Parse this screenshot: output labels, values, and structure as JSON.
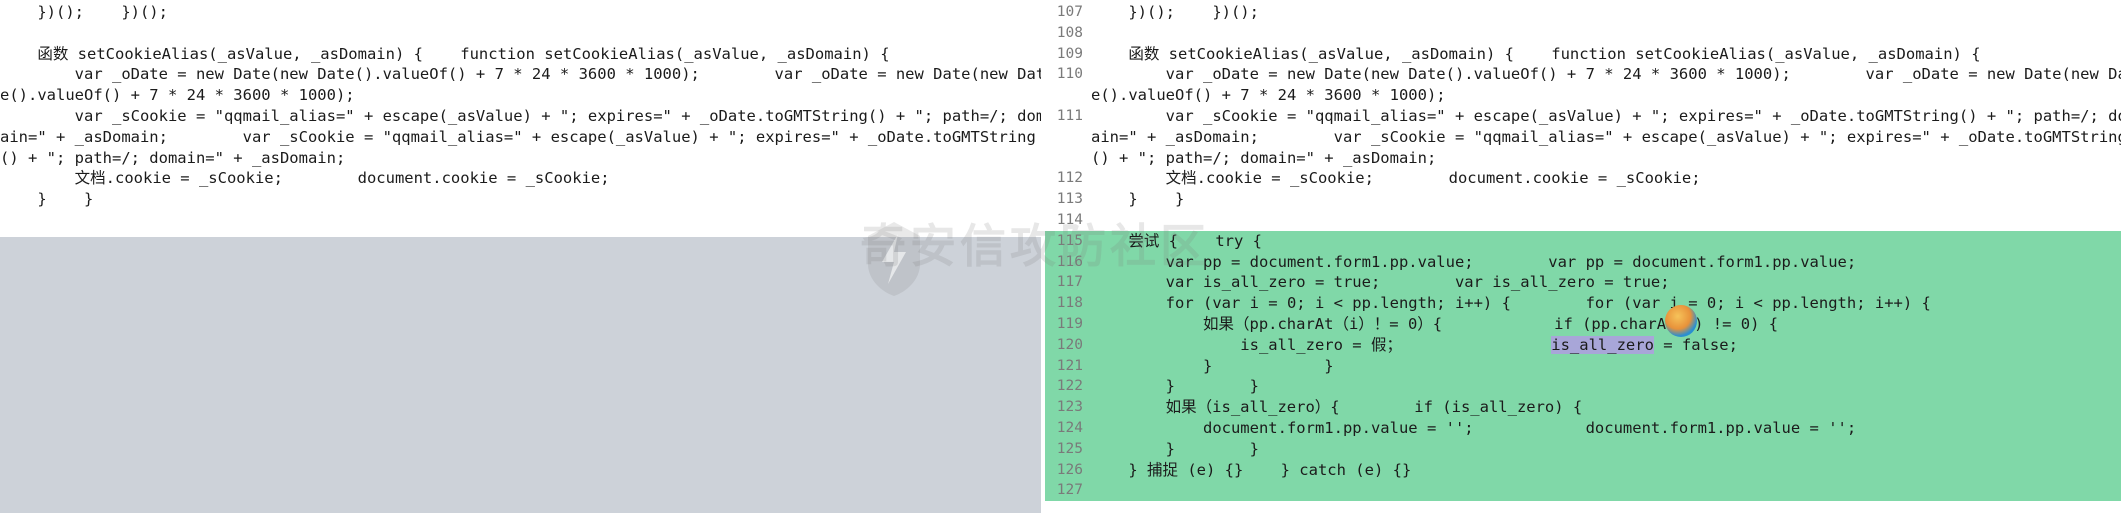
{
  "left_pane": {
    "lines": [
      {
        "code": "    })();    })();"
      },
      {
        "code": ""
      },
      {
        "code": "    函数 setCookieAlias(_asValue, _asDomain) {    function setCookieAlias(_asValue, _asDomain) {"
      },
      {
        "code": "        var _oDate = new Date(new Date().valueOf() + 7 * 24 * 3600 * 1000);        var _oDate = new Date(new Dat\ne().valueOf() + 7 * 24 * 3600 * 1000);"
      },
      {
        "code": "        var _sCookie = \"qqmail_alias=\" + escape(_asValue) + \"; expires=\" + _oDate.toGMTString() + \"; path=/; dom\nain=\" + _asDomain;        var _sCookie = \"qqmail_alias=\" + escape(_asValue) + \"; expires=\" + _oDate.toGMTString\n() + \"; path=/; domain=\" + _asDomain;"
      },
      {
        "code": "        文档.cookie = _sCookie;        document.cookie = _sCookie;"
      },
      {
        "code": "    }    }"
      }
    ]
  },
  "right_pane": {
    "lines": [
      {
        "num": "107",
        "code": "    })();    })();"
      },
      {
        "num": "108",
        "code": ""
      },
      {
        "num": "109",
        "code": "    函数 setCookieAlias(_asValue, _asDomain) {    function setCookieAlias(_asValue, _asDomain) {"
      },
      {
        "num": "110",
        "code": "        var _oDate = new Date(new Date().valueOf() + 7 * 24 * 3600 * 1000);        var _oDate = new Date(new Dat\ne().valueOf() + 7 * 24 * 3600 * 1000);"
      },
      {
        "num": "111",
        "code": "        var _sCookie = \"qqmail_alias=\" + escape(_asValue) + \"; expires=\" + _oDate.toGMTString() + \"; path=/; dom\nain=\" + _asDomain;        var _sCookie = \"qqmail_alias=\" + escape(_asValue) + \"; expires=\" + _oDate.toGMTString\n() + \"; path=/; domain=\" + _asDomain;"
      },
      {
        "num": "112",
        "code": "        文档.cookie = _sCookie;        document.cookie = _sCookie;"
      },
      {
        "num": "113",
        "code": "    }    }"
      },
      {
        "num": "114",
        "code": ""
      },
      {
        "num": "115",
        "code": "    尝试 {    try {"
      },
      {
        "num": "116",
        "code": "        var pp = document.form1.pp.value;        var pp = document.form1.pp.value;"
      },
      {
        "num": "117",
        "code": "        var is_all_zero = true;        var is_all_zero = true;"
      },
      {
        "num": "118",
        "code": "        for (var i = 0; i < pp.length; i++) {        for (var i = 0; i < pp.length; i++) {"
      },
      {
        "num": "119",
        "code": "            如果（pp.charAt（i）！= 0）{            if (pp.charAt(i) != 0) {"
      },
      {
        "num": "120",
        "code_before": "                is_all_zero = 假；                ",
        "code_highlight": "is_all_zero",
        "code_after": " = false;"
      },
      {
        "num": "121",
        "code": "            }            }"
      },
      {
        "num": "122",
        "code": "        }        }"
      },
      {
        "num": "123",
        "code": "        如果（is_all_zero）{        if (is_all_zero) {"
      },
      {
        "num": "124",
        "code": "            document.form1.pp.value = '';            document.form1.pp.value = '';"
      },
      {
        "num": "125",
        "code": "        }        }"
      },
      {
        "num": "126",
        "code": "    } 捕捉 (e) {}    } catch (e) {}"
      },
      {
        "num": "127",
        "code": ""
      }
    ]
  },
  "watermark": {
    "text": "奇安信攻防社区"
  },
  "colors": {
    "added": "#80d8a8",
    "empty": "#cdd2d9",
    "highlight": "#a8a6d8"
  }
}
